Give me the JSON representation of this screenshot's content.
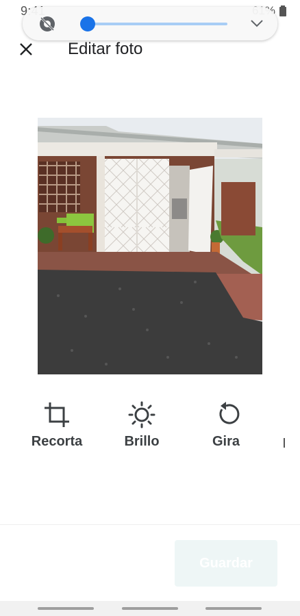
{
  "status_bar": {
    "time": "9:41",
    "battery": "61%",
    "icons": [
      "vibrate-icon",
      "image-icon",
      "alarm-icon",
      "wifi-icon",
      "signal-icon",
      "battery-icon"
    ]
  },
  "brightness": {
    "level": 0.04,
    "auto_icon": "brightness-auto-off-icon",
    "expand_icon": "chevron-down-icon"
  },
  "header": {
    "title": "Editar foto",
    "close_icon": "close-icon"
  },
  "tools": [
    {
      "label": "Recorta",
      "icon": "crop-icon"
    },
    {
      "label": "Brillo",
      "icon": "brightness-icon"
    },
    {
      "label": "Gira",
      "icon": "rotate-icon"
    }
  ],
  "footer": {
    "save_label": "Guardar"
  },
  "colors": {
    "accent": "#1a73e8",
    "slider_track": "#a8cdf5",
    "save_disabled_bg": "#eef6f6"
  }
}
